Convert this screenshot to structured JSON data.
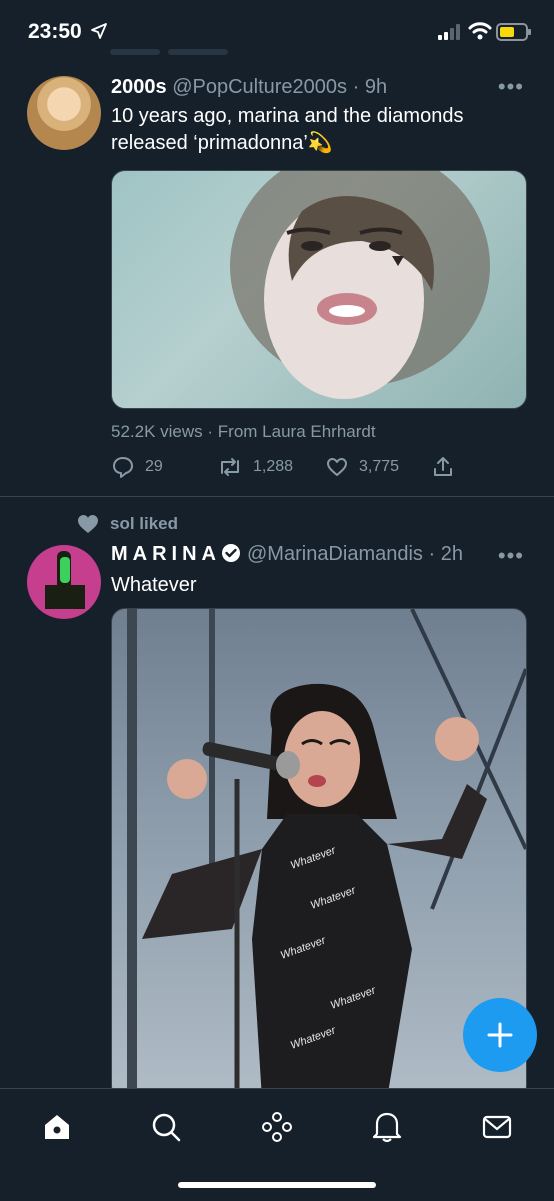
{
  "status": {
    "time": "23:50"
  },
  "tweet1": {
    "name": "2000s",
    "handle": "@PopCulture2000s",
    "time": "9h",
    "text_line1": "10 years ago, marina and the diamonds",
    "text_line2": "released ‘primadonna’",
    "emoji": "💫",
    "views": "52.2K views",
    "source": "From Laura Ehrhardt",
    "replies": "29",
    "retweets": "1,288",
    "likes": "3,775"
  },
  "tweet2": {
    "social_context": "sol liked",
    "name": "MARINA",
    "handle": "@MarinaDiamandis",
    "time": "2h",
    "text": "Whatever"
  },
  "fab": {
    "icon": "plus-icon"
  },
  "tabs": [
    "home-icon",
    "search-icon",
    "spaces-icon",
    "notifications-icon",
    "messages-icon"
  ]
}
